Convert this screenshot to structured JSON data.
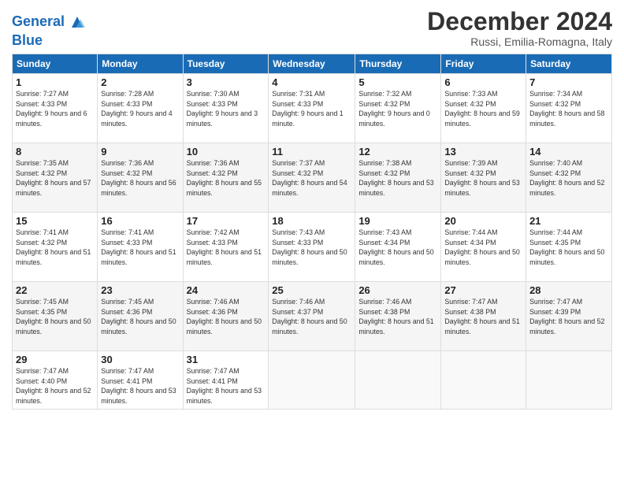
{
  "header": {
    "logo_line1": "General",
    "logo_line2": "Blue",
    "month_title": "December 2024",
    "subtitle": "Russi, Emilia-Romagna, Italy"
  },
  "weekdays": [
    "Sunday",
    "Monday",
    "Tuesday",
    "Wednesday",
    "Thursday",
    "Friday",
    "Saturday"
  ],
  "weeks": [
    [
      {
        "day": "1",
        "sunrise": "Sunrise: 7:27 AM",
        "sunset": "Sunset: 4:33 PM",
        "daylight": "Daylight: 9 hours and 6 minutes."
      },
      {
        "day": "2",
        "sunrise": "Sunrise: 7:28 AM",
        "sunset": "Sunset: 4:33 PM",
        "daylight": "Daylight: 9 hours and 4 minutes."
      },
      {
        "day": "3",
        "sunrise": "Sunrise: 7:30 AM",
        "sunset": "Sunset: 4:33 PM",
        "daylight": "Daylight: 9 hours and 3 minutes."
      },
      {
        "day": "4",
        "sunrise": "Sunrise: 7:31 AM",
        "sunset": "Sunset: 4:33 PM",
        "daylight": "Daylight: 9 hours and 1 minute."
      },
      {
        "day": "5",
        "sunrise": "Sunrise: 7:32 AM",
        "sunset": "Sunset: 4:32 PM",
        "daylight": "Daylight: 9 hours and 0 minutes."
      },
      {
        "day": "6",
        "sunrise": "Sunrise: 7:33 AM",
        "sunset": "Sunset: 4:32 PM",
        "daylight": "Daylight: 8 hours and 59 minutes."
      },
      {
        "day": "7",
        "sunrise": "Sunrise: 7:34 AM",
        "sunset": "Sunset: 4:32 PM",
        "daylight": "Daylight: 8 hours and 58 minutes."
      }
    ],
    [
      {
        "day": "8",
        "sunrise": "Sunrise: 7:35 AM",
        "sunset": "Sunset: 4:32 PM",
        "daylight": "Daylight: 8 hours and 57 minutes."
      },
      {
        "day": "9",
        "sunrise": "Sunrise: 7:36 AM",
        "sunset": "Sunset: 4:32 PM",
        "daylight": "Daylight: 8 hours and 56 minutes."
      },
      {
        "day": "10",
        "sunrise": "Sunrise: 7:36 AM",
        "sunset": "Sunset: 4:32 PM",
        "daylight": "Daylight: 8 hours and 55 minutes."
      },
      {
        "day": "11",
        "sunrise": "Sunrise: 7:37 AM",
        "sunset": "Sunset: 4:32 PM",
        "daylight": "Daylight: 8 hours and 54 minutes."
      },
      {
        "day": "12",
        "sunrise": "Sunrise: 7:38 AM",
        "sunset": "Sunset: 4:32 PM",
        "daylight": "Daylight: 8 hours and 53 minutes."
      },
      {
        "day": "13",
        "sunrise": "Sunrise: 7:39 AM",
        "sunset": "Sunset: 4:32 PM",
        "daylight": "Daylight: 8 hours and 53 minutes."
      },
      {
        "day": "14",
        "sunrise": "Sunrise: 7:40 AM",
        "sunset": "Sunset: 4:32 PM",
        "daylight": "Daylight: 8 hours and 52 minutes."
      }
    ],
    [
      {
        "day": "15",
        "sunrise": "Sunrise: 7:41 AM",
        "sunset": "Sunset: 4:32 PM",
        "daylight": "Daylight: 8 hours and 51 minutes."
      },
      {
        "day": "16",
        "sunrise": "Sunrise: 7:41 AM",
        "sunset": "Sunset: 4:33 PM",
        "daylight": "Daylight: 8 hours and 51 minutes."
      },
      {
        "day": "17",
        "sunrise": "Sunrise: 7:42 AM",
        "sunset": "Sunset: 4:33 PM",
        "daylight": "Daylight: 8 hours and 51 minutes."
      },
      {
        "day": "18",
        "sunrise": "Sunrise: 7:43 AM",
        "sunset": "Sunset: 4:33 PM",
        "daylight": "Daylight: 8 hours and 50 minutes."
      },
      {
        "day": "19",
        "sunrise": "Sunrise: 7:43 AM",
        "sunset": "Sunset: 4:34 PM",
        "daylight": "Daylight: 8 hours and 50 minutes."
      },
      {
        "day": "20",
        "sunrise": "Sunrise: 7:44 AM",
        "sunset": "Sunset: 4:34 PM",
        "daylight": "Daylight: 8 hours and 50 minutes."
      },
      {
        "day": "21",
        "sunrise": "Sunrise: 7:44 AM",
        "sunset": "Sunset: 4:35 PM",
        "daylight": "Daylight: 8 hours and 50 minutes."
      }
    ],
    [
      {
        "day": "22",
        "sunrise": "Sunrise: 7:45 AM",
        "sunset": "Sunset: 4:35 PM",
        "daylight": "Daylight: 8 hours and 50 minutes."
      },
      {
        "day": "23",
        "sunrise": "Sunrise: 7:45 AM",
        "sunset": "Sunset: 4:36 PM",
        "daylight": "Daylight: 8 hours and 50 minutes."
      },
      {
        "day": "24",
        "sunrise": "Sunrise: 7:46 AM",
        "sunset": "Sunset: 4:36 PM",
        "daylight": "Daylight: 8 hours and 50 minutes."
      },
      {
        "day": "25",
        "sunrise": "Sunrise: 7:46 AM",
        "sunset": "Sunset: 4:37 PM",
        "daylight": "Daylight: 8 hours and 50 minutes."
      },
      {
        "day": "26",
        "sunrise": "Sunrise: 7:46 AM",
        "sunset": "Sunset: 4:38 PM",
        "daylight": "Daylight: 8 hours and 51 minutes."
      },
      {
        "day": "27",
        "sunrise": "Sunrise: 7:47 AM",
        "sunset": "Sunset: 4:38 PM",
        "daylight": "Daylight: 8 hours and 51 minutes."
      },
      {
        "day": "28",
        "sunrise": "Sunrise: 7:47 AM",
        "sunset": "Sunset: 4:39 PM",
        "daylight": "Daylight: 8 hours and 52 minutes."
      }
    ],
    [
      {
        "day": "29",
        "sunrise": "Sunrise: 7:47 AM",
        "sunset": "Sunset: 4:40 PM",
        "daylight": "Daylight: 8 hours and 52 minutes."
      },
      {
        "day": "30",
        "sunrise": "Sunrise: 7:47 AM",
        "sunset": "Sunset: 4:41 PM",
        "daylight": "Daylight: 8 hours and 53 minutes."
      },
      {
        "day": "31",
        "sunrise": "Sunrise: 7:47 AM",
        "sunset": "Sunset: 4:41 PM",
        "daylight": "Daylight: 8 hours and 53 minutes."
      },
      null,
      null,
      null,
      null
    ]
  ]
}
